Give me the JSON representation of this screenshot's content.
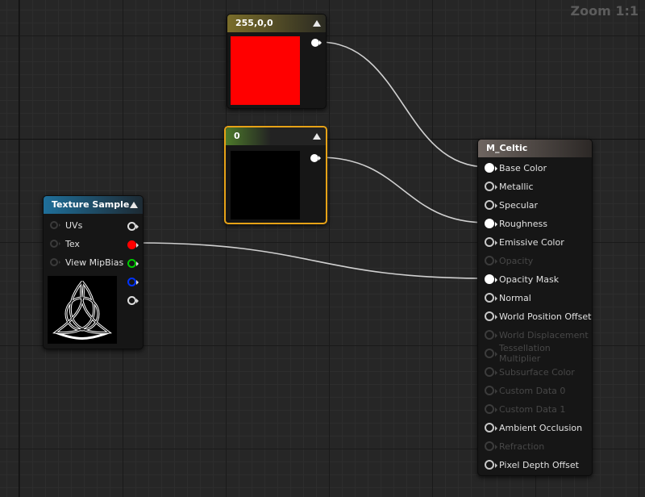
{
  "zoom": {
    "label": "Zoom 1:1"
  },
  "constant_color_node": {
    "title": "255,0,0",
    "header_color": "#7a6d2a",
    "preview_color": "#ff0000"
  },
  "constant_scalar_node": {
    "title": "0",
    "header_color": "#4d7a2a",
    "preview_color": "#000000",
    "selected": true
  },
  "texture_sample_node": {
    "title": "Texture Sample",
    "header_color": "#1f6f9a",
    "inputs": [
      {
        "label": "UVs"
      },
      {
        "label": "Tex"
      },
      {
        "label": "View MipBias"
      }
    ],
    "outputs": [
      {
        "channel": "RGB",
        "color": "#dddddd"
      },
      {
        "channel": "R",
        "color": "#ff0000"
      },
      {
        "channel": "G",
        "color": "#00cc00"
      },
      {
        "channel": "B",
        "color": "#0033ff"
      },
      {
        "channel": "A",
        "color": "#dddddd"
      }
    ],
    "preview_icon": "celtic-triquetra-knot"
  },
  "material_node": {
    "title": "M_Celtic",
    "header_color": "#6e6560",
    "inputs": [
      {
        "label": "Base Color",
        "state": "connected"
      },
      {
        "label": "Metallic",
        "state": "active"
      },
      {
        "label": "Specular",
        "state": "active"
      },
      {
        "label": "Roughness",
        "state": "connected"
      },
      {
        "label": "Emissive Color",
        "state": "active"
      },
      {
        "label": "Opacity",
        "state": "disabled"
      },
      {
        "label": "Opacity Mask",
        "state": "connected"
      },
      {
        "label": "Normal",
        "state": "active"
      },
      {
        "label": "World Position Offset",
        "state": "active"
      },
      {
        "label": "World Displacement",
        "state": "disabled"
      },
      {
        "label": "Tessellation Multiplier",
        "state": "disabled"
      },
      {
        "label": "Subsurface Color",
        "state": "disabled"
      },
      {
        "label": "Custom Data 0",
        "state": "disabled"
      },
      {
        "label": "Custom Data 1",
        "state": "disabled"
      },
      {
        "label": "Ambient Occlusion",
        "state": "active"
      },
      {
        "label": "Refraction",
        "state": "disabled"
      },
      {
        "label": "Pixel Depth Offset",
        "state": "active"
      }
    ]
  },
  "wire_color": "#d0d0d0"
}
